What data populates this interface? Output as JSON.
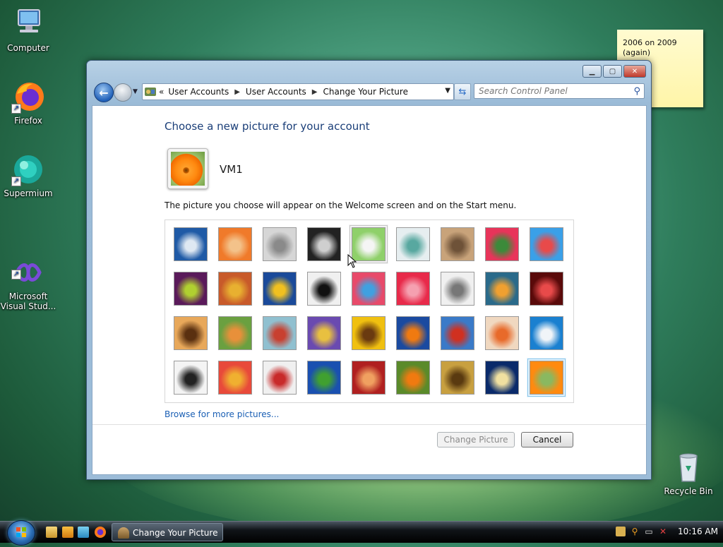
{
  "desktop": {
    "icons": [
      {
        "label": "Computer"
      },
      {
        "label": "Firefox"
      },
      {
        "label": "Supermium"
      },
      {
        "label": "Microsoft\nVisual Stud..."
      },
      {
        "label": "Recycle Bin"
      }
    ],
    "sticky_note": "2006 on 2009\n(again)"
  },
  "window": {
    "breadcrumb": [
      "User Accounts",
      "User Accounts",
      "Change Your Picture"
    ],
    "search_placeholder": "Search Control Panel",
    "heading": "Choose a new picture for your account",
    "username": "VM1",
    "description": "The picture you choose will appear on the Welcome screen and on the Start menu.",
    "pictures": [
      {
        "name": "ferris-wheel",
        "colors": [
          "#1f5aa6",
          "#dfe8f2"
        ]
      },
      {
        "name": "starfish",
        "colors": [
          "#f07a2a",
          "#f3c28a"
        ]
      },
      {
        "name": "robot-dog",
        "colors": [
          "#d6d6d6",
          "#8a8a8a"
        ]
      },
      {
        "name": "record-player",
        "colors": [
          "#222222",
          "#cfcfcf"
        ]
      },
      {
        "name": "lucky-cat",
        "colors": [
          "#8fd06a",
          "#f5f5f5"
        ]
      },
      {
        "name": "gyroscope",
        "colors": [
          "#e6eef0",
          "#58a8a0"
        ]
      },
      {
        "name": "kitten",
        "colors": [
          "#c8a37a",
          "#6e5238"
        ]
      },
      {
        "name": "pink-flower",
        "colors": [
          "#e8345a",
          "#3c8a3a"
        ]
      },
      {
        "name": "pinwheel",
        "colors": [
          "#3aa0e8",
          "#e84a4a"
        ]
      },
      {
        "name": "ball",
        "colors": [
          "#5a1a5a",
          "#b0d030"
        ]
      },
      {
        "name": "yarn",
        "colors": [
          "#c85a2a",
          "#e8b030"
        ]
      },
      {
        "name": "leaf",
        "colors": [
          "#1a4a9a",
          "#f0c020"
        ]
      },
      {
        "name": "border-collie",
        "colors": [
          "#f0f0f0",
          "#111111"
        ]
      },
      {
        "name": "crayons",
        "colors": [
          "#e84a6a",
          "#40a0e0"
        ]
      },
      {
        "name": "paper-star",
        "colors": [
          "#e82a4a",
          "#f5a0b0"
        ]
      },
      {
        "name": "jacks",
        "colors": [
          "#f0f0f0",
          "#777777"
        ]
      },
      {
        "name": "stairs",
        "colors": [
          "#2a6a8a",
          "#f0a030"
        ]
      },
      {
        "name": "paper-crane",
        "colors": [
          "#5a0a0a",
          "#e84a4a"
        ]
      },
      {
        "name": "guitar",
        "colors": [
          "#e8a85a",
          "#5a3010"
        ]
      },
      {
        "name": "pomeranian",
        "colors": [
          "#6aa040",
          "#e8903a"
        ]
      },
      {
        "name": "toy-robot",
        "colors": [
          "#90c0d0",
          "#c84030"
        ]
      },
      {
        "name": "scarves",
        "colors": [
          "#6a4ab0",
          "#e8c040"
        ]
      },
      {
        "name": "sunflower",
        "colors": [
          "#f0c010",
          "#6a3a10"
        ]
      },
      {
        "name": "goldfish",
        "colors": [
          "#1a4aa0",
          "#f07a10"
        ]
      },
      {
        "name": "hot-air-balloon",
        "colors": [
          "#3a7ac8",
          "#d03020"
        ]
      },
      {
        "name": "daruma-doll",
        "colors": [
          "#f0d8c0",
          "#e86a2a"
        ]
      },
      {
        "name": "sailboat",
        "colors": [
          "#1a80d0",
          "#f0f4f8"
        ]
      },
      {
        "name": "soccer-ball",
        "colors": [
          "#f4f4f4",
          "#222222"
        ]
      },
      {
        "name": "striped-fabric",
        "colors": [
          "#e84a3a",
          "#f0b030"
        ]
      },
      {
        "name": "marbles",
        "colors": [
          "#f0f0f0",
          "#c82a2a"
        ]
      },
      {
        "name": "green-window",
        "colors": [
          "#1a50b0",
          "#40a030"
        ]
      },
      {
        "name": "woven-pattern",
        "colors": [
          "#b02020",
          "#f0a060"
        ]
      },
      {
        "name": "butterfly",
        "colors": [
          "#5a8a2a",
          "#f07a10"
        ]
      },
      {
        "name": "wicker",
        "colors": [
          "#c8a040",
          "#5a3a10"
        ]
      },
      {
        "name": "lighthouse",
        "colors": [
          "#0a2a6a",
          "#f0e0a0"
        ]
      },
      {
        "name": "orange-flower",
        "colors": [
          "#ff8a10",
          "#8ab860"
        ]
      }
    ],
    "selected_index": 35,
    "hovered_index": 4,
    "browse_link": "Browse for more pictures...",
    "buttons": {
      "change": "Change Picture",
      "cancel": "Cancel"
    }
  },
  "taskbar": {
    "active_task": "Change Your Picture",
    "clock": "10:16 AM"
  }
}
